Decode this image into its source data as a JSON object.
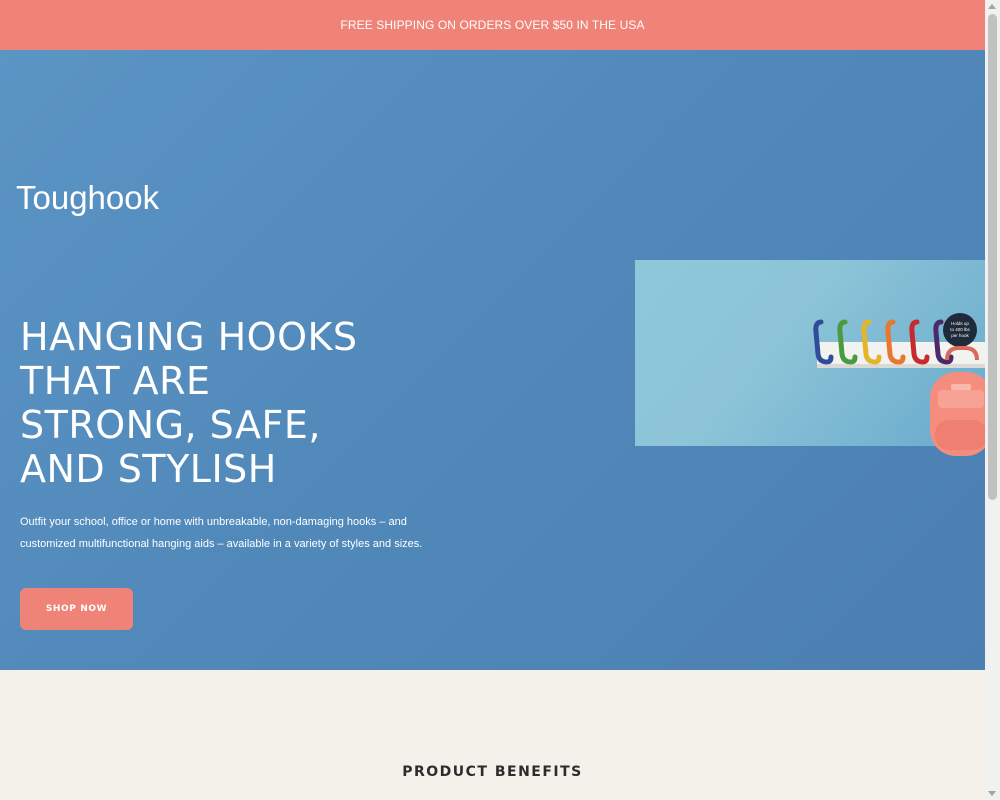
{
  "announcement": {
    "text": "FREE SHIPPING ON ORDERS OVER $50 IN THE USA"
  },
  "brand": {
    "logo_text": "Toughook",
    "primary_color": "#ef8377",
    "hero_color": "#5189bb",
    "background_color": "#f4f1eb"
  },
  "hero": {
    "headline_lines": [
      "HANGING HOOKS",
      "THAT ARE",
      "STRONG, SAFE,",
      "AND STYLISH"
    ],
    "subtext": "Outfit your school, office or home with unbreakable, non-damaging hooks – and customized multifunctional hanging aids – available in a variety of styles and sizes.",
    "cta_label": "SHOP NOW",
    "image": {
      "hook_colors": [
        "#2f4c9a",
        "#4a9a3e",
        "#e4b52a",
        "#e8782e",
        "#c8282e",
        "#4a2a6a"
      ],
      "badge_text": "Holds up to 400 lbs per hook"
    }
  },
  "benefits": {
    "title": "PRODUCT BENEFITS"
  },
  "scrollbar": {
    "icon_up": "arrow-up-icon",
    "icon_down": "arrow-down-icon"
  }
}
